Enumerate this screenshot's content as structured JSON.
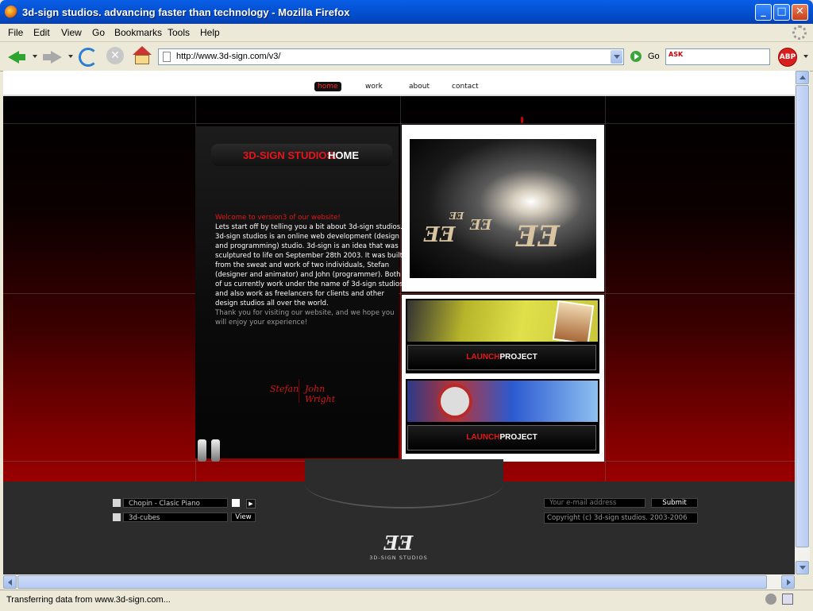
{
  "window": {
    "title": "3d-sign studios. advancing faster than technology - Mozilla Firefox"
  },
  "menu": {
    "items": [
      "File",
      "Edit",
      "View",
      "Go",
      "Bookmarks",
      "Tools",
      "Help"
    ]
  },
  "toolbar": {
    "url": "http://www.3d-sign.com/v3/",
    "go_label": "Go",
    "search_engine": "ASK",
    "adblock_label": "ABP"
  },
  "site": {
    "nav": {
      "items": [
        "home",
        "work",
        "about",
        "contact"
      ],
      "active": "home"
    },
    "section_title": {
      "part1": "3D-SIGN STUDIOS:",
      "part2": "HOME"
    },
    "intro": {
      "welcome": "Welcome to version3 of our website!",
      "body": "Lets start off by telling you a bit about 3d-sign studios. 3d-sign studios is an online web development (design and programming) studio. 3d-sign is an idea that was sculptured to life on September 28th 2003. It was built from the sweat and work of two individuals, Stefan (designer and animator) and John (programmer). Both of us currently work under the name of 3d-sign studios and also work as freelancers for clients and other design studios all over the world.",
      "thanks": "Thank you for visiting our website, and we hope you will enjoy your experience!"
    },
    "signatures": [
      "Stefan",
      "John Wright"
    ],
    "feature_logo": "ƎƎ",
    "projects": [
      {
        "launch_word": "LAUNCH",
        "project_word": "PROJECT"
      },
      {
        "launch_word": "LAUNCH",
        "project_word": "PROJECT"
      }
    ],
    "footer": {
      "music_track": "Chopin - Clasic Piano",
      "background_select": "3d-cubes",
      "view_button": "View",
      "email_placeholder": "Your e-mail address",
      "submit_label": "Submit",
      "copyright": "Copyright (c) 3d-sign studios. 2003-2006",
      "logo_mark": "ƎƎ",
      "logo_text": "3D-SIGN STUDIOS"
    }
  },
  "status": {
    "text": "Transferring data from www.3d-sign.com..."
  },
  "colors": {
    "accent_red": "#e01818",
    "xp_blue": "#0453d6"
  }
}
